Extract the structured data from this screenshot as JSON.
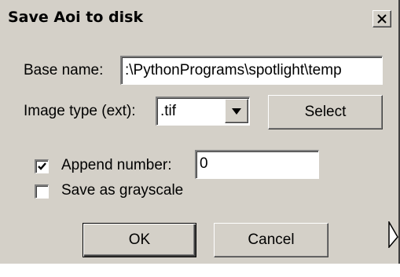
{
  "dialog": {
    "title": "Save Aoi to disk",
    "close_label": "×"
  },
  "base_name": {
    "label": "Base name:",
    "value": ":\\PythonPrograms\\spotlight\\temp"
  },
  "image_type": {
    "label": "Image type (ext):",
    "selected": ".tif",
    "select_button": "Select"
  },
  "append_number": {
    "label": "Append number:",
    "checked": true,
    "value": "0"
  },
  "grayscale": {
    "label": "Save as grayscale",
    "checked": false
  },
  "buttons": {
    "ok": "OK",
    "cancel": "Cancel"
  },
  "icons": {
    "close": "close-icon",
    "dropdown": "chevron-down-icon",
    "check": "check-icon",
    "cursor": "mouse-cursor-icon"
  }
}
